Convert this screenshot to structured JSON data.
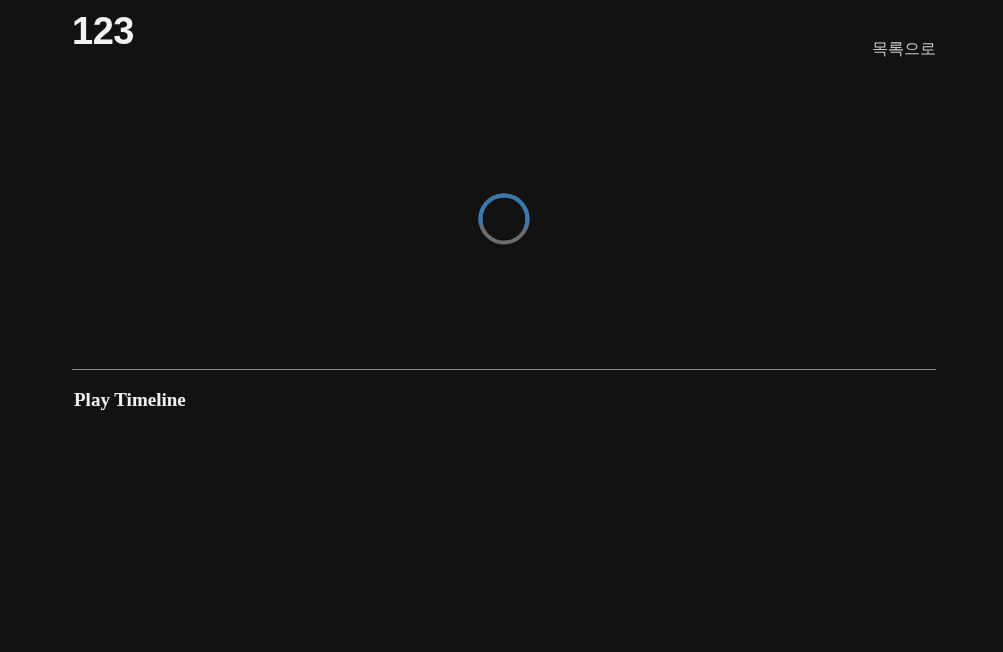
{
  "header": {
    "title": "123",
    "back_link": "목록으로"
  },
  "content": {
    "loading": true
  },
  "section": {
    "title": "Play Timeline"
  }
}
